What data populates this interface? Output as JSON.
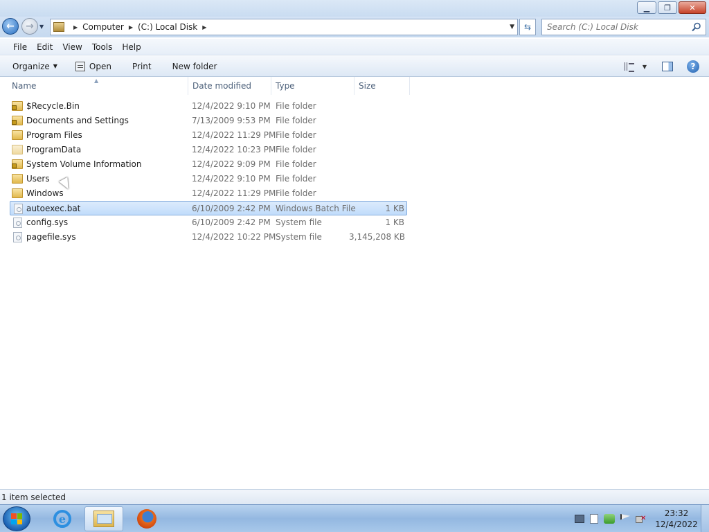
{
  "window": {
    "minimize_glyph": "▁",
    "maximize_glyph": "❐",
    "close_glyph": "✕"
  },
  "address": {
    "crumbs": [
      "Computer",
      "(C:) Local Disk"
    ],
    "search_placeholder": "Search (C:) Local Disk"
  },
  "menu": {
    "items": [
      "File",
      "Edit",
      "View",
      "Tools",
      "Help"
    ]
  },
  "toolbar": {
    "organize": "Organize",
    "open": "Open",
    "print": "Print",
    "new_folder": "New folder"
  },
  "columns": {
    "name": "Name",
    "date": "Date modified",
    "type": "Type",
    "size": "Size"
  },
  "files": [
    {
      "name": "$Recycle.Bin",
      "date": "12/4/2022 9:10 PM",
      "type": "File folder",
      "size": "",
      "icon": "locked-folder-icon",
      "selected": false
    },
    {
      "name": "Documents and Settings",
      "date": "7/13/2009 9:53 PM",
      "type": "File folder",
      "size": "",
      "icon": "locked-folder-icon",
      "selected": false
    },
    {
      "name": "Program Files",
      "date": "12/4/2022 11:29 PM",
      "type": "File folder",
      "size": "",
      "icon": "folder-icon",
      "selected": false
    },
    {
      "name": "ProgramData",
      "date": "12/4/2022 10:23 PM",
      "type": "File folder",
      "size": "",
      "icon": "hidden-folder-icon",
      "selected": false
    },
    {
      "name": "System Volume Information",
      "date": "12/4/2022 9:09 PM",
      "type": "File folder",
      "size": "",
      "icon": "locked-folder-icon",
      "selected": false
    },
    {
      "name": "Users",
      "date": "12/4/2022 9:10 PM",
      "type": "File folder",
      "size": "",
      "icon": "folder-icon",
      "selected": false
    },
    {
      "name": "Windows",
      "date": "12/4/2022 11:29 PM",
      "type": "File folder",
      "size": "",
      "icon": "folder-icon",
      "selected": false
    },
    {
      "name": "autoexec.bat",
      "date": "6/10/2009 2:42 PM",
      "type": "Windows Batch File",
      "size": "1 KB",
      "icon": "system-file-icon",
      "selected": true
    },
    {
      "name": "config.sys",
      "date": "6/10/2009 2:42 PM",
      "type": "System file",
      "size": "1 KB",
      "icon": "system-file-icon",
      "selected": false
    },
    {
      "name": "pagefile.sys",
      "date": "12/4/2022 10:22 PM",
      "type": "System file",
      "size": "3,145,208 KB",
      "icon": "system-file-icon",
      "selected": false
    }
  ],
  "status": {
    "text": "1 item selected"
  },
  "taskbar": {
    "clock_time": "23:32",
    "clock_date": "12/4/2022"
  },
  "colors": {
    "selection": "#c1dcfb",
    "accent": "#1d4f8c"
  }
}
